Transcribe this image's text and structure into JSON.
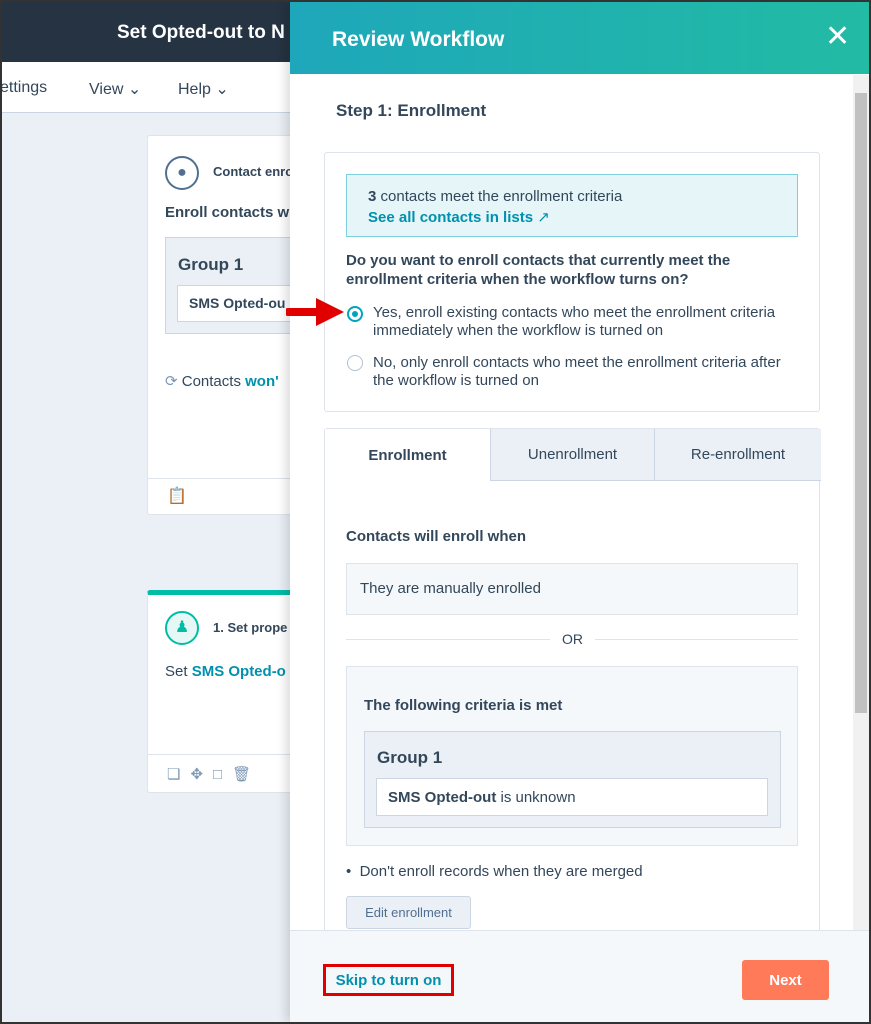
{
  "app": {
    "title": "Set Opted-out to N",
    "menu": [
      "ettings",
      "View",
      "Help"
    ]
  },
  "canvas": {
    "trigger_card": {
      "title": "Contact enro",
      "subtitle": "Enroll contacts w",
      "group": "Group 1",
      "filter": "SMS Opted-ou",
      "reenroll_prefix": "Contacts",
      "reenroll_link": "won'"
    },
    "action_card": {
      "title": "1. Set prope",
      "text_prefix": "Set",
      "text_link": "SMS Opted-o"
    }
  },
  "panel": {
    "title": "Review Workflow",
    "step": "Step 1: Enrollment",
    "info": {
      "count": "3",
      "count_text": "contacts meet the enrollment criteria",
      "link": "See all contacts in lists"
    },
    "question": "Do you want to enroll contacts that currently meet the enrollment criteria when the workflow turns on?",
    "options": [
      {
        "label": "Yes, enroll existing contacts who meet the enrollment criteria immediately when the workflow is turned on",
        "selected": true
      },
      {
        "label": "No, only enroll contacts who meet the enrollment criteria after the workflow is turned on",
        "selected": false
      }
    ],
    "tabs": [
      {
        "label": "Enrollment",
        "active": true
      },
      {
        "label": "Unenrollment",
        "active": false
      },
      {
        "label": "Re-enrollment",
        "active": false
      }
    ],
    "enroll_heading": "Contacts will enroll when",
    "manual": "They are manually enrolled",
    "or": "OR",
    "criteria_heading": "The following criteria is met",
    "group": "Group 1",
    "filter_bold": "SMS Opted-out",
    "filter_rest": "is unknown",
    "bullet": "Don't enroll records when they are merged",
    "edit_button": "Edit enrollment",
    "skip": "Skip to turn on",
    "next": "Next"
  },
  "colors": {
    "accent": "#00a4bd",
    "next": "#ff7a59",
    "annotation": "#e00000"
  }
}
